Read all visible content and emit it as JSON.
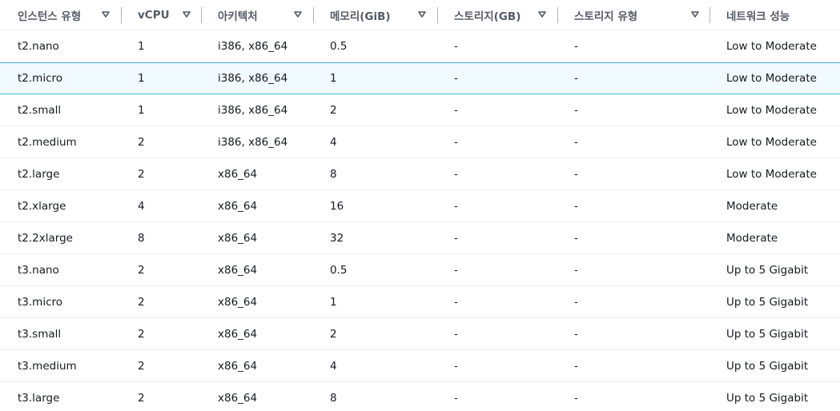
{
  "columns": [
    {
      "label": "인스턴스 유형"
    },
    {
      "label": "vCPU"
    },
    {
      "label": "아키텍처"
    },
    {
      "label": "메모리(GiB)"
    },
    {
      "label": "스토리지(GB)"
    },
    {
      "label": "스토리지 유형"
    },
    {
      "label": "네트워크 성능"
    }
  ],
  "rows": [
    {
      "type": "t2.nano",
      "vcpu": "1",
      "arch": "i386, x86_64",
      "memory": "0.5",
      "storage": "-",
      "storage_type": "-",
      "network": "Low to Moderate"
    },
    {
      "type": "t2.micro",
      "vcpu": "1",
      "arch": "i386, x86_64",
      "memory": "1",
      "storage": "-",
      "storage_type": "-",
      "network": "Low to Moderate",
      "selected": true
    },
    {
      "type": "t2.small",
      "vcpu": "1",
      "arch": "i386, x86_64",
      "memory": "2",
      "storage": "-",
      "storage_type": "-",
      "network": "Low to Moderate"
    },
    {
      "type": "t2.medium",
      "vcpu": "2",
      "arch": "i386, x86_64",
      "memory": "4",
      "storage": "-",
      "storage_type": "-",
      "network": "Low to Moderate"
    },
    {
      "type": "t2.large",
      "vcpu": "2",
      "arch": "x86_64",
      "memory": "8",
      "storage": "-",
      "storage_type": "-",
      "network": "Low to Moderate"
    },
    {
      "type": "t2.xlarge",
      "vcpu": "4",
      "arch": "x86_64",
      "memory": "16",
      "storage": "-",
      "storage_type": "-",
      "network": "Moderate"
    },
    {
      "type": "t2.2xlarge",
      "vcpu": "8",
      "arch": "x86_64",
      "memory": "32",
      "storage": "-",
      "storage_type": "-",
      "network": "Moderate"
    },
    {
      "type": "t3.nano",
      "vcpu": "2",
      "arch": "x86_64",
      "memory": "0.5",
      "storage": "-",
      "storage_type": "-",
      "network": "Up to 5 Gigabit"
    },
    {
      "type": "t3.micro",
      "vcpu": "2",
      "arch": "x86_64",
      "memory": "1",
      "storage": "-",
      "storage_type": "-",
      "network": "Up to 5 Gigabit"
    },
    {
      "type": "t3.small",
      "vcpu": "2",
      "arch": "x86_64",
      "memory": "2",
      "storage": "-",
      "storage_type": "-",
      "network": "Up to 5 Gigabit"
    },
    {
      "type": "t3.medium",
      "vcpu": "2",
      "arch": "x86_64",
      "memory": "4",
      "storage": "-",
      "storage_type": "-",
      "network": "Up to 5 Gigabit"
    },
    {
      "type": "t3.large",
      "vcpu": "2",
      "arch": "x86_64",
      "memory": "8",
      "storage": "-",
      "storage_type": "-",
      "network": "Up to 5 Gigabit"
    }
  ],
  "icons": {
    "sort": "sort-caret-down-icon"
  },
  "colors": {
    "header_text": "#545b64",
    "cell_text": "#16191f",
    "row_border": "#eaeded",
    "selected_bg": "#f1faff",
    "selected_border": "#44b9d6",
    "divider": "#aab7b8"
  }
}
